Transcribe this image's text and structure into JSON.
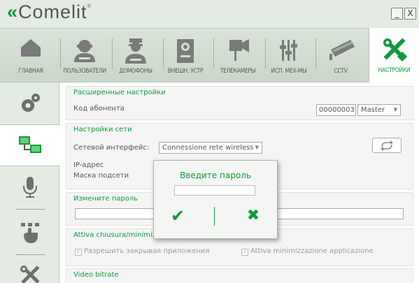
{
  "app": {
    "logo_text": "Comelit",
    "logo_mark": "«",
    "registered": "®",
    "minimize_label": "_",
    "close_label": "X"
  },
  "colors": {
    "accent": "#0e9a3d",
    "toolbar": "#d3ddd3",
    "sidebar": "#e3ebe3"
  },
  "toolbar": {
    "tabs": [
      {
        "label": "ГЛАВНАЯ",
        "icon": "home-icon"
      },
      {
        "label": "ПОЛЬЗОВАТЕЛИ",
        "icon": "user-icon"
      },
      {
        "label": "ДОМОФОНЫ",
        "icon": "concierge-icon"
      },
      {
        "label": "ВНЕШН. УСТР",
        "icon": "entrance-panel-icon"
      },
      {
        "label": "ТЕЛЕКАМЕРЫ",
        "icon": "camera-icon"
      },
      {
        "label": "ИСП. МЕХ-МЫ",
        "icon": "actuator-icon"
      },
      {
        "label": "CCTV",
        "icon": "cctv-icon"
      },
      {
        "label": "НАСТРОЙКИ",
        "icon": "tools-icon",
        "active": true
      }
    ]
  },
  "sidebar": {
    "items": [
      {
        "icon": "gears-icon"
      },
      {
        "icon": "network-icon",
        "active": true
      },
      {
        "icon": "microphone-icon"
      },
      {
        "icon": "touch-icon"
      },
      {
        "icon": "tools-icon"
      }
    ]
  },
  "advanced": {
    "title": "Расширенные настройки",
    "subscriber_label": "Код абонента",
    "subscriber_code": "00000003",
    "role_value": "Master"
  },
  "network": {
    "title": "Настройки сети",
    "interface_label": "Сетевой интерфейс:",
    "interface_value": "Connessione rete wireless",
    "ip_label": "IP-адрес",
    "mask_label": "Маска подсети"
  },
  "password": {
    "title": "Измените пароль",
    "value": ""
  },
  "closing": {
    "title": "Attiva chiusura/minimizz",
    "allow_close_label": "Разрешить закрывая приложения",
    "minimize_label": "Attiva minimizzazione applicazione"
  },
  "video": {
    "title": "Video bitrate"
  },
  "dialog": {
    "title": "Введите пароль",
    "input_value": "",
    "ok_symbol": "✔",
    "cancel_symbol": "✖"
  }
}
